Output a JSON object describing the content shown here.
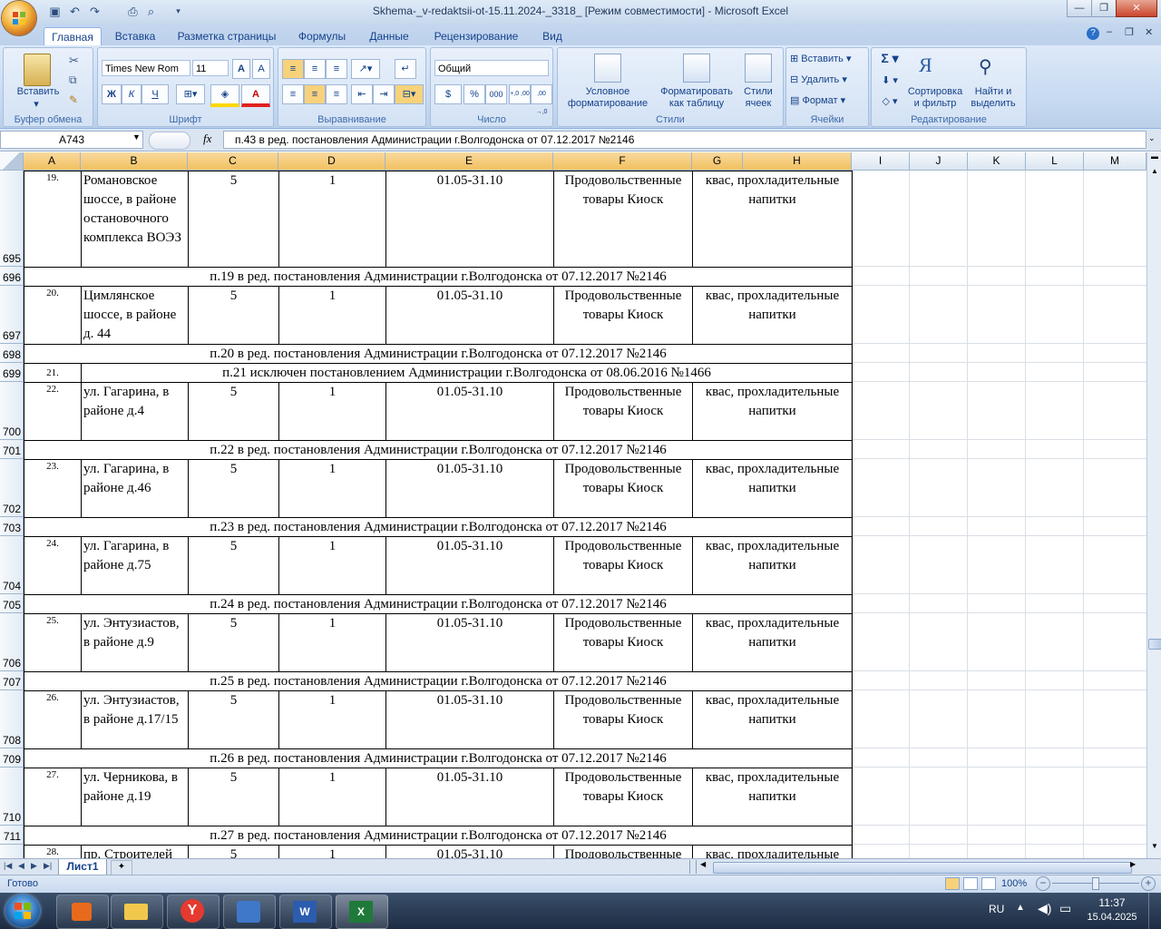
{
  "window": {
    "title": "Skhema-_v-redaktsii-ot-15.11.2024-_3318_  [Режим совместимости] - Microsoft Excel"
  },
  "ribbon_tabs": [
    "Главная",
    "Вставка",
    "Разметка страницы",
    "Формулы",
    "Данные",
    "Рецензирование",
    "Вид"
  ],
  "ribbon": {
    "clipboard": {
      "paste": "Вставить",
      "label": "Буфер обмена"
    },
    "font": {
      "name": "Times New Rom",
      "size": "11",
      "bold": "Ж",
      "italic": "К",
      "underline": "Ч",
      "label": "Шрифт"
    },
    "alignment": {
      "label": "Выравнивание"
    },
    "number": {
      "format": "Общий",
      "currency": "$",
      "percent": "%",
      "thousands": "000",
      "inc_dec": "+,0 ,00",
      "dec_dec": ",00 →,0",
      "label": "Число"
    },
    "styles": {
      "cond": "Условное",
      "cond2": "форматирование",
      "table": "Форматировать",
      "table2": "как таблицу",
      "cell": "Стили",
      "cell2": "ячеек",
      "label": "Стили"
    },
    "cells": {
      "insert": "Вставить",
      "delete": "Удалить",
      "format": "Формат",
      "label": "Ячейки"
    },
    "editing": {
      "sort": "Сортировка",
      "sort2": "и фильтр",
      "find": "Найти и",
      "find2": "выделить",
      "label": "Редактирование"
    }
  },
  "formula_bar": {
    "name_box": "A743",
    "fx": "fx",
    "formula": "п.43 в ред. постановления Администрации г.Волгодонска от 07.12.2017 №2146"
  },
  "columns": [
    "A",
    "B",
    "C",
    "D",
    "E",
    "F",
    "G",
    "H",
    "I",
    "J",
    "K",
    "L",
    "M"
  ],
  "rows": [
    {
      "n": "695",
      "type": "data",
      "num": "19.",
      "addr": "Романовское шоссе, в районе остановочного комплекса ВОЭЗ",
      "c": "5",
      "d": "1",
      "period": "01.05-31.10",
      "goods": "Продовольственные товары Киоск",
      "assort": "квас, прохладительные напитки"
    },
    {
      "n": "696",
      "type": "note",
      "text": "п.19 в ред. постановления Администрации г.Волгодонска от 07.12.2017 №2146"
    },
    {
      "n": "697",
      "type": "data",
      "num": "20.",
      "addr": "Цимлянское шоссе, в районе д. 44",
      "c": "5",
      "d": "1",
      "period": "01.05-31.10",
      "goods": "Продовольственные товары Киоск",
      "assort": "квас, прохладительные напитки"
    },
    {
      "n": "698",
      "type": "note",
      "text": "п.20 в ред. постановления Администрации г.Волгодонска от 07.12.2017 №2146"
    },
    {
      "n": "699",
      "type": "excl",
      "num": "21.",
      "text": "п.21 исключен  постановлением Администрации г.Волгодонска от 08.06.2016 №1466"
    },
    {
      "n": "700",
      "type": "data",
      "num": "22.",
      "addr": "ул. Гагарина, в районе д.4",
      "c": "5",
      "d": "1",
      "period": "01.05-31.10",
      "goods": "Продовольственные товары Киоск",
      "assort": "квас, прохладительные напитки"
    },
    {
      "n": "701",
      "type": "note",
      "text": "п.22 в ред. постановления Администрации г.Волгодонска от 07.12.2017 №2146"
    },
    {
      "n": "702",
      "type": "data",
      "num": "23.",
      "addr": "ул. Гагарина, в районе д.46",
      "c": "5",
      "d": "1",
      "period": "01.05-31.10",
      "goods": "Продовольственные товары Киоск",
      "assort": "квас, прохладительные напитки"
    },
    {
      "n": "703",
      "type": "note",
      "text": "п.23 в ред. постановления Администрации г.Волгодонска от 07.12.2017 №2146"
    },
    {
      "n": "704",
      "type": "data",
      "num": "24.",
      "addr": "ул. Гагарина, в районе д.75",
      "c": "5",
      "d": "1",
      "period": "01.05-31.10",
      "goods": "Продовольственные товары Киоск",
      "assort": "квас, прохладительные напитки"
    },
    {
      "n": "705",
      "type": "note",
      "text": "п.24 в ред. постановления Администрации г.Волгодонска от 07.12.2017 №2146"
    },
    {
      "n": "706",
      "type": "data",
      "num": "25.",
      "addr": "ул. Энтузиастов, в районе д.9",
      "c": "5",
      "d": "1",
      "period": "01.05-31.10",
      "goods": "Продовольственные товары Киоск",
      "assort": "квас, прохладительные напитки"
    },
    {
      "n": "707",
      "type": "note",
      "text": "п.25 в ред. постановления Администрации г.Волгодонска от 07.12.2017 №2146"
    },
    {
      "n": "708",
      "type": "data",
      "num": "26.",
      "addr": "ул. Энтузиастов, в районе д.17/15",
      "c": "5",
      "d": "1",
      "period": "01.05-31.10",
      "goods": "Продовольственные товары Киоск",
      "assort": "квас, прохладительные напитки"
    },
    {
      "n": "709",
      "type": "note",
      "text": "п.26 в ред. постановления Администрации г.Волгодонска от 07.12.2017 №2146"
    },
    {
      "n": "710",
      "type": "data",
      "num": "27.",
      "addr": "ул. Черникова, в районе д.19",
      "c": "5",
      "d": "1",
      "period": "01.05-31.10",
      "goods": "Продовольственные товары Киоск",
      "assort": "квас, прохладительные напитки"
    },
    {
      "n": "711",
      "type": "note",
      "text": "п.27 в ред. постановления Администрации г.Волгодонска от 07.12.2017 №2146"
    },
    {
      "n": "",
      "type": "data",
      "num": "28.",
      "addr": "пр. Строителей",
      "c": "5",
      "d": "1",
      "period": "01.05-31.10",
      "goods": "Продовольственные",
      "assort": "квас, прохладительные"
    }
  ],
  "sheet_tab": "Лист1",
  "status": {
    "ready": "Готово",
    "zoom": "100%"
  },
  "taskbar": {
    "lang": "RU",
    "time": "11:37",
    "date": "15.04.2025"
  }
}
